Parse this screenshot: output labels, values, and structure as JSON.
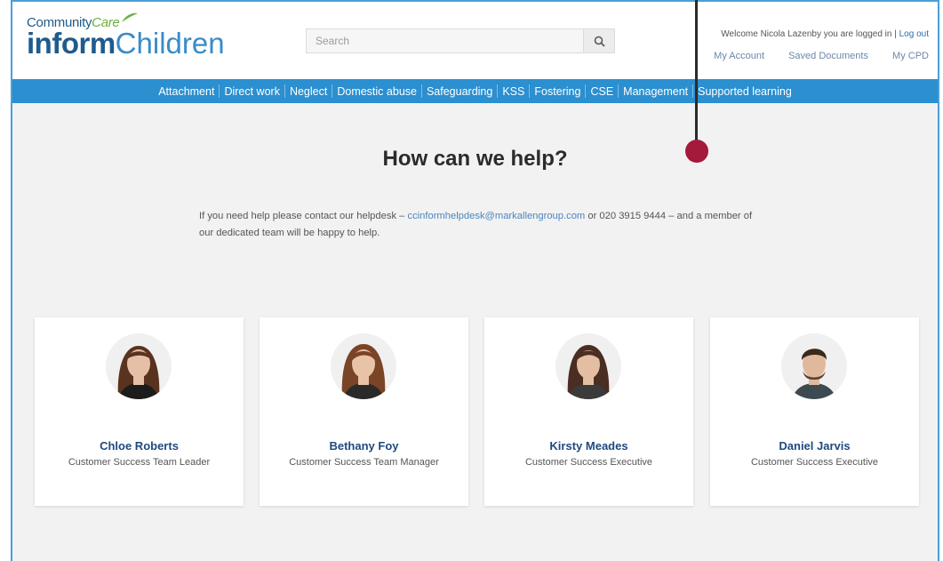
{
  "logo": {
    "community": "Community",
    "care": "Care",
    "inform": "inform",
    "children": "Children"
  },
  "search": {
    "placeholder": "Search"
  },
  "user": {
    "welcome": "Welcome Nicola Lazenby you are logged in",
    "separator": "|",
    "logout": "Log out",
    "links": [
      "My Account",
      "Saved Documents",
      "My CPD"
    ]
  },
  "nav": [
    "Attachment",
    "Direct work",
    "Neglect",
    "Domestic abuse",
    "Safeguarding",
    "KSS",
    "Fostering",
    "CSE",
    "Management",
    "Supported learning"
  ],
  "main": {
    "title": "How can we help?",
    "help_pre": "If you need help please contact our helpdesk – ",
    "help_email": "ccinformhelpdesk@markallengroup.com",
    "help_post": " or 020 3915 9444 – and a member of our dedicated team will be happy to help."
  },
  "team": [
    {
      "name": "Chloe Roberts",
      "role": "Customer Success Team Leader",
      "hair": "#5a3320",
      "skin": "#e6c0a6",
      "top": "#1c1c1c"
    },
    {
      "name": "Bethany Foy",
      "role": "Customer Success Team Manager",
      "hair": "#7a4426",
      "skin": "#e8c3a8",
      "top": "#2a2a2a"
    },
    {
      "name": "Kirsty Meades",
      "role": "Customer Success Executive",
      "hair": "#4a2e22",
      "skin": "#e4bea2",
      "top": "#3b3b3b"
    },
    {
      "name": "Daniel Jarvis",
      "role": "Customer Success Executive",
      "hair": "#3a2a1e",
      "skin": "#e0b89c",
      "top": "#3e4a52"
    }
  ],
  "colors": {
    "nav": "#2b8fd0",
    "brand": "#1f5b8c",
    "accent_green": "#6cae3f",
    "pointer": "#a31a3a"
  }
}
